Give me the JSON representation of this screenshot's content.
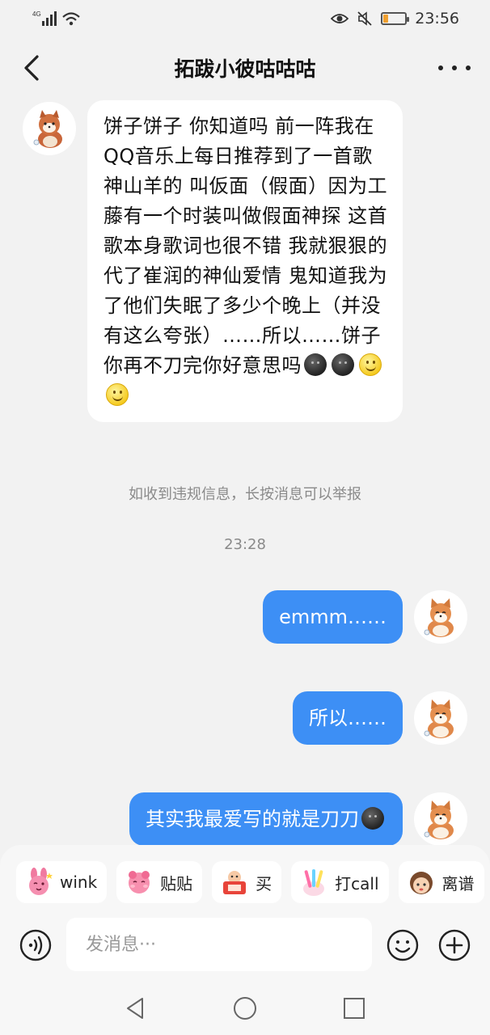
{
  "status_bar": {
    "network": "4G",
    "time": "23:56",
    "battery_level": 0.2,
    "icons": [
      "signal-icon",
      "wifi-icon",
      "eye-icon",
      "mute-icon",
      "battery-icon"
    ]
  },
  "header": {
    "title": "拓跋小彼咕咕咕",
    "back_icon": "chevron-left-icon",
    "more_icon": "more-dots-icon"
  },
  "messages": {
    "incoming": {
      "text_main": "饼子饼子 你知道吗 前一阵我在QQ音乐上每日推荐到了一首歌 神山羊的 叫仮面（假面）因为工藤有一个时装叫做假面神探 这首歌本身歌词也很不错 我就狠狠的代了崔润的神仙爱情 鬼知道我为了他们失眠了多少个晚上（并没有这么夸张）……所以……饼子你再不刀完你好意思吗",
      "trailing_emojis": [
        "dark-smiley",
        "dark-smiley",
        "smile",
        "smile"
      ]
    },
    "notice": "如收到违规信息，长按消息可以举报",
    "timestamp": "23:28",
    "outgoing": [
      {
        "text": "emmm……"
      },
      {
        "text": "所以……"
      },
      {
        "text": "其实我最爱写的就是刀刀",
        "emoji": "dark-smiley"
      }
    ]
  },
  "stickers": [
    {
      "label": "wink",
      "icon": "pink-bunny-sticker"
    },
    {
      "label": "贴贴",
      "icon": "pink-hug-sticker"
    },
    {
      "label": "买",
      "icon": "red-buy-sticker"
    },
    {
      "label": "打call",
      "icon": "glowstick-sticker"
    },
    {
      "label": "离谱",
      "icon": "girl-face-sticker"
    }
  ],
  "composer": {
    "placeholder": "发消息···",
    "value": "",
    "voice_icon": "voice-icon",
    "emoji_icon": "emoji-icon",
    "plus_icon": "plus-icon"
  },
  "nav_bar": {
    "icons": [
      "nav-back-icon",
      "nav-home-icon",
      "nav-recent-icon"
    ]
  },
  "colors": {
    "accent": "#3d8ff5",
    "background": "#f2f2f2",
    "bubble_in": "#ffffff"
  }
}
